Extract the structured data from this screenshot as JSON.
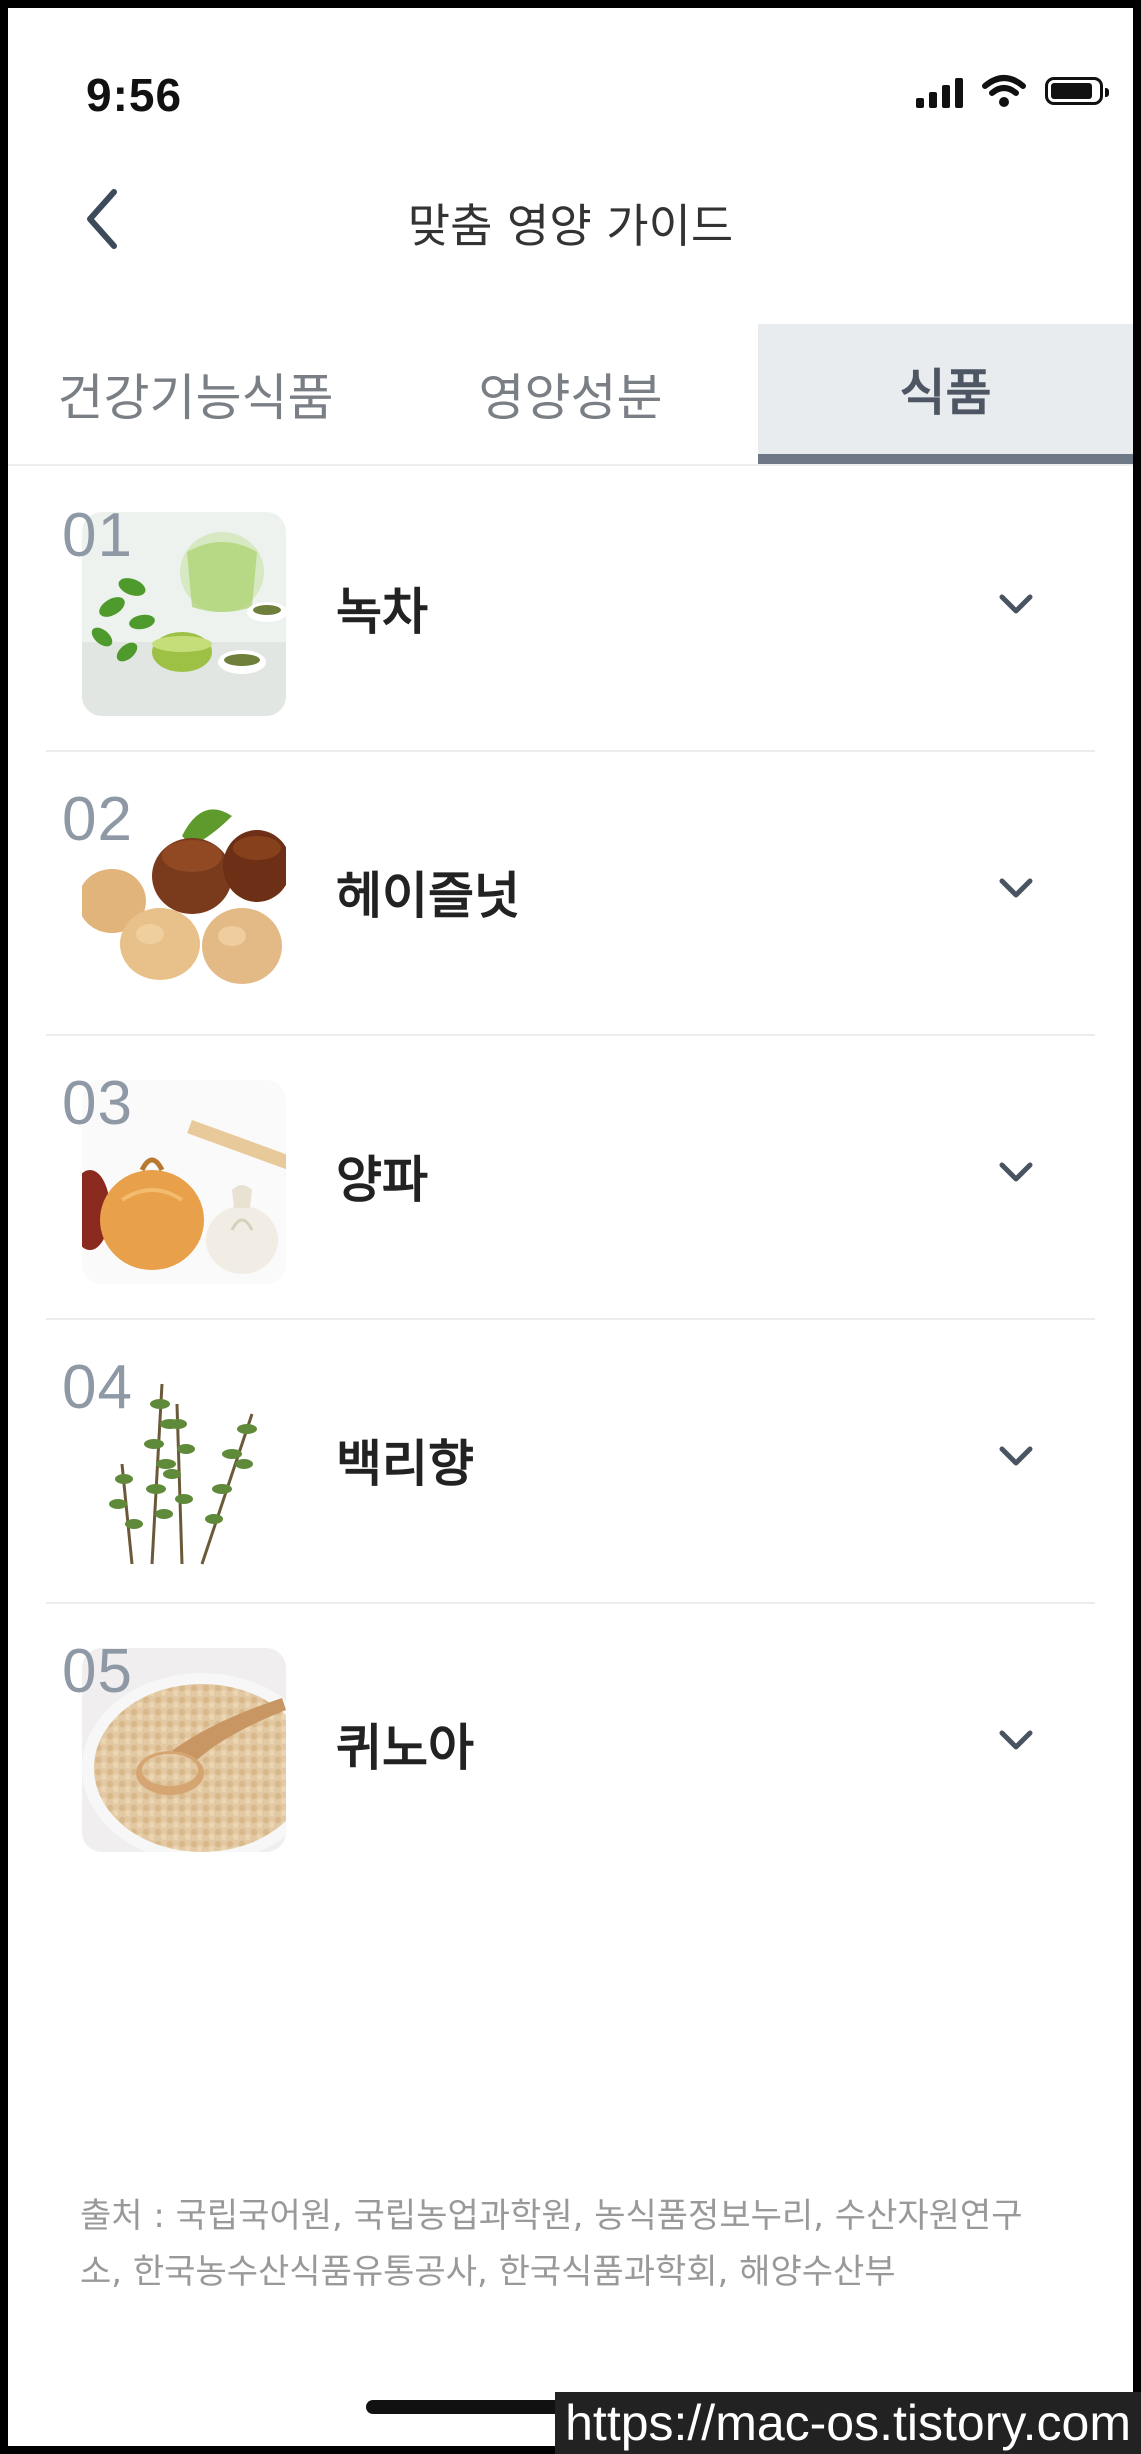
{
  "status_bar": {
    "time": "9:56"
  },
  "header": {
    "title": "맞춤 영양 가이드"
  },
  "tabs": [
    {
      "label": "건강기능식품",
      "active": false
    },
    {
      "label": "영양성분",
      "active": false
    },
    {
      "label": "식품",
      "active": true
    }
  ],
  "foods": [
    {
      "num": "01",
      "name": "녹차",
      "image": "green-tea-image"
    },
    {
      "num": "02",
      "name": "헤이즐넛",
      "image": "hazelnut-image"
    },
    {
      "num": "03",
      "name": "양파",
      "image": "onion-image"
    },
    {
      "num": "04",
      "name": "백리향",
      "image": "thyme-image"
    },
    {
      "num": "05",
      "name": "퀴노아",
      "image": "quinoa-image"
    }
  ],
  "footer": {
    "source_line1": "출처 : 국립국어원, 국립농업과학원, 농식품정보누리, 수산자원연구",
    "source_line2": "소, 한국농수산식품유통공사, 한국식품과학회, 해양수산부"
  },
  "watermark": "https://mac-os.tistory.com",
  "colors": {
    "accent": "#6e7886",
    "number": "#8f99a6",
    "active_tab_bg": "#e9ecef"
  }
}
